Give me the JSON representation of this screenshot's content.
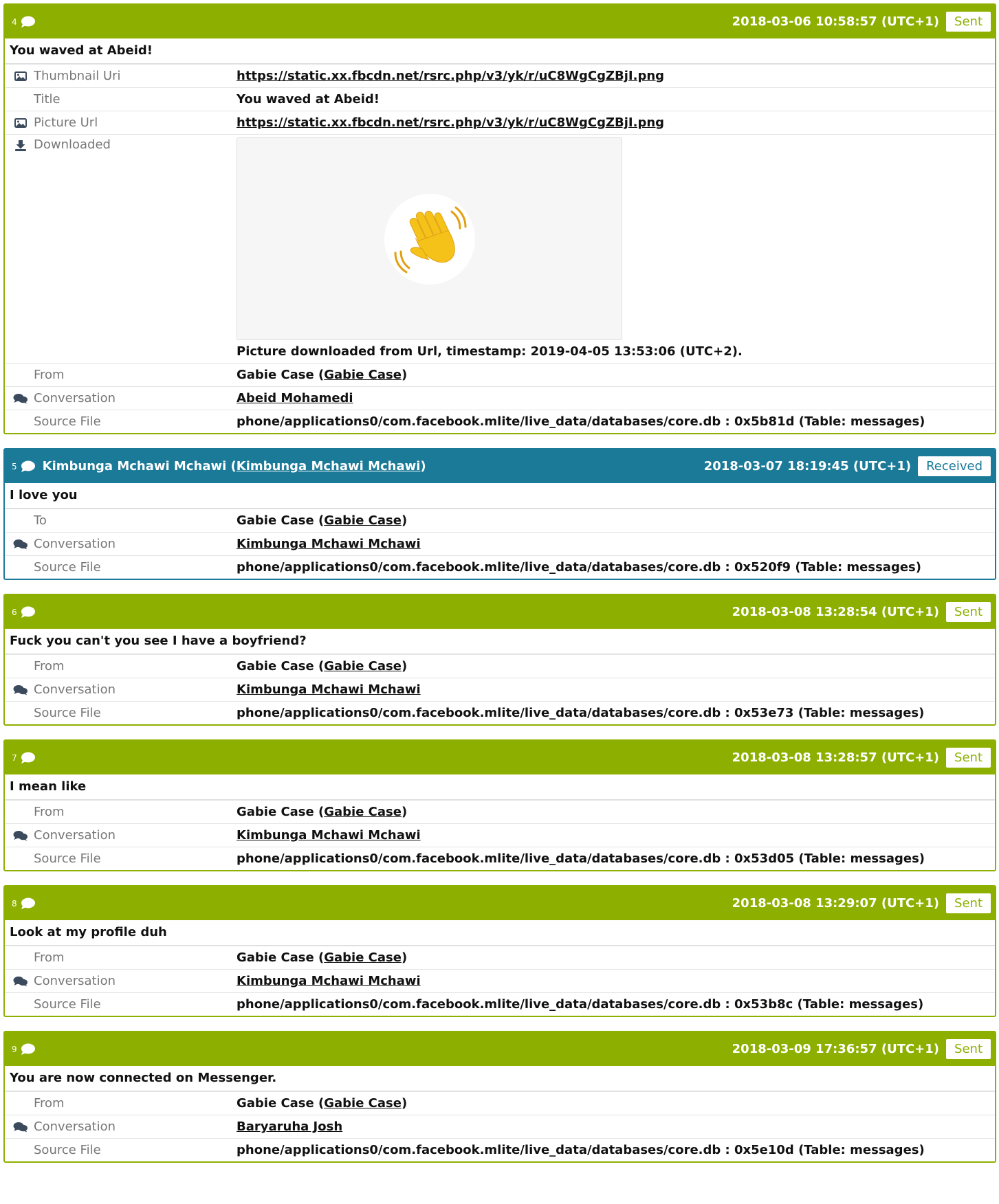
{
  "colors": {
    "sent": "#8db000",
    "received": "#1a7a98"
  },
  "labels": {
    "thumbnail_uri": "Thumbnail Uri",
    "title": "Title",
    "picture_url": "Picture Url",
    "downloaded": "Downloaded",
    "from": "From",
    "to": "To",
    "conversation": "Conversation",
    "source_file": "Source File"
  },
  "messages": [
    {
      "num": "4",
      "direction": "sent",
      "timestamp": "2018-03-06 10:58:57 (UTC+1)",
      "status": "Sent",
      "text": "You waved at Abeid!",
      "thumbnail_uri": "https://static.xx.fbcdn.net/rsrc.php/v3/yk/r/uC8WgCgZBjI.png",
      "title": "You waved at Abeid!",
      "picture_url": "https://static.xx.fbcdn.net/rsrc.php/v3/yk/r/uC8WgCgZBjI.png",
      "downloaded_note": "Picture downloaded from Url, timestamp: 2019-04-05 13:53:06 (UTC+2).",
      "from_name": "Gabie Case",
      "from_link": "Gabie Case",
      "conversation": "Abeid Mohamedi",
      "source_file": "phone/applications0/com.facebook.mlite/live_data/databases/core.db : 0x5b81d (Table: messages)"
    },
    {
      "num": "5",
      "direction": "received",
      "sender_name": "Kimbunga Mchawi Mchawi",
      "sender_link": "Kimbunga Mchawi Mchawi",
      "timestamp": "2018-03-07 18:19:45 (UTC+1)",
      "status": "Received",
      "text": "I love you",
      "to_name": "Gabie Case",
      "to_link": "Gabie Case",
      "conversation": "Kimbunga Mchawi Mchawi",
      "source_file": "phone/applications0/com.facebook.mlite/live_data/databases/core.db : 0x520f9 (Table: messages)"
    },
    {
      "num": "6",
      "direction": "sent",
      "timestamp": "2018-03-08 13:28:54 (UTC+1)",
      "status": "Sent",
      "text": "Fuck you can't you see I have a boyfriend?",
      "from_name": "Gabie Case",
      "from_link": "Gabie Case",
      "conversation": "Kimbunga Mchawi Mchawi",
      "source_file": "phone/applications0/com.facebook.mlite/live_data/databases/core.db : 0x53e73 (Table: messages)"
    },
    {
      "num": "7",
      "direction": "sent",
      "timestamp": "2018-03-08 13:28:57 (UTC+1)",
      "status": "Sent",
      "text": "I mean like",
      "from_name": "Gabie Case",
      "from_link": "Gabie Case",
      "conversation": "Kimbunga Mchawi Mchawi",
      "source_file": "phone/applications0/com.facebook.mlite/live_data/databases/core.db : 0x53d05 (Table: messages)"
    },
    {
      "num": "8",
      "direction": "sent",
      "timestamp": "2018-03-08 13:29:07 (UTC+1)",
      "status": "Sent",
      "text": "Look at my profile duh",
      "from_name": "Gabie Case",
      "from_link": "Gabie Case",
      "conversation": "Kimbunga Mchawi Mchawi",
      "source_file": "phone/applications0/com.facebook.mlite/live_data/databases/core.db : 0x53b8c (Table: messages)"
    },
    {
      "num": "9",
      "direction": "sent",
      "timestamp": "2018-03-09 17:36:57 (UTC+1)",
      "status": "Sent",
      "text": "You are now connected on Messenger.",
      "from_name": "Gabie Case",
      "from_link": "Gabie Case",
      "conversation": "Baryaruha Josh",
      "source_file": "phone/applications0/com.facebook.mlite/live_data/databases/core.db : 0x5e10d (Table: messages)"
    }
  ]
}
